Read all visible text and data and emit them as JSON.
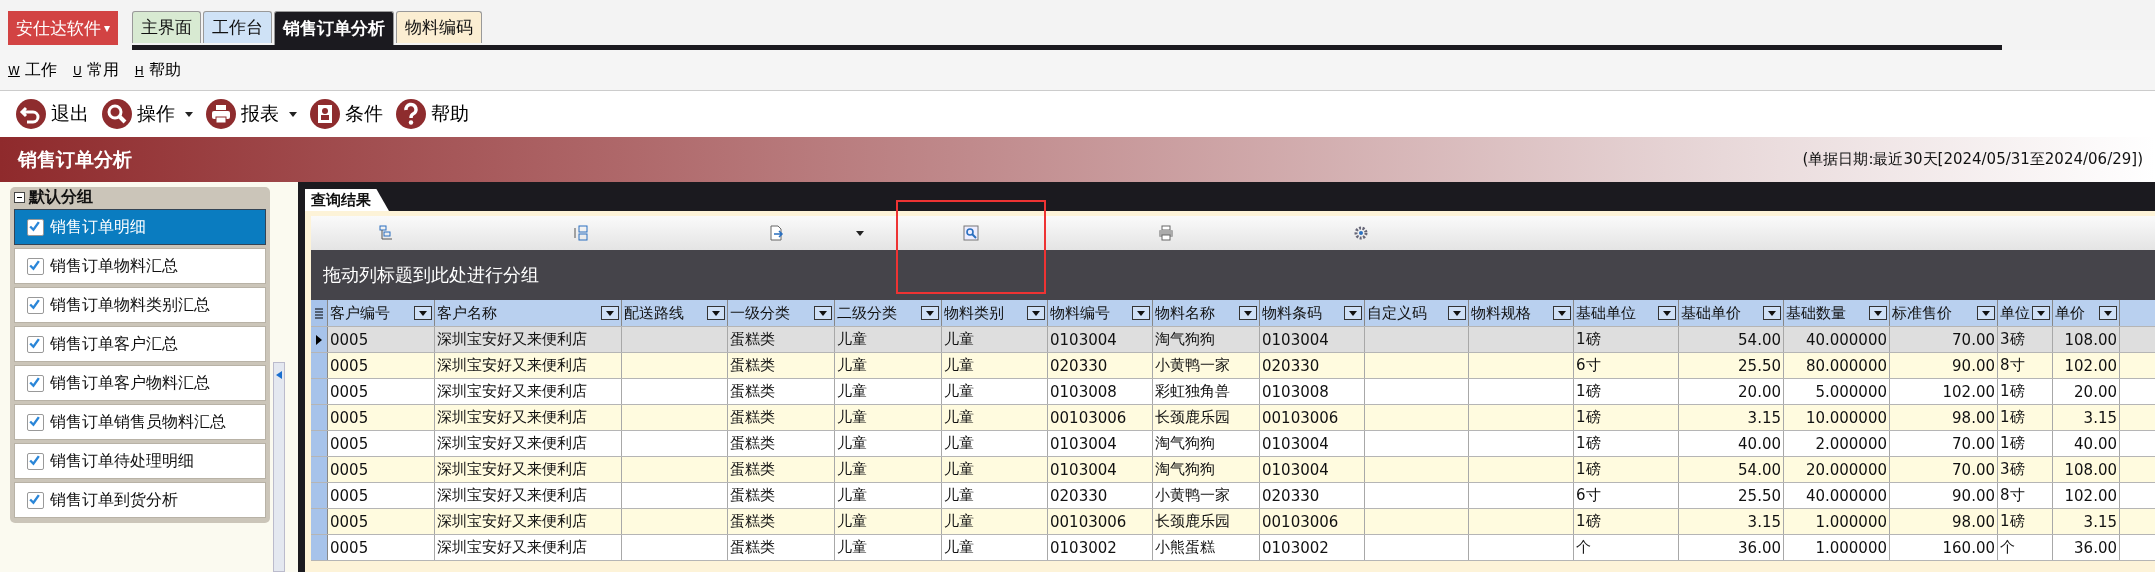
{
  "app_menu": {
    "label": "安仕达软件",
    "caret": "▾"
  },
  "tabs": [
    {
      "label": "主界面",
      "selected": false,
      "color": "#d8ead2"
    },
    {
      "label": "工作台",
      "selected": false,
      "color": "#cfe2f6"
    },
    {
      "label": "销售订单分析",
      "selected": true,
      "color": "#1b1a1f"
    },
    {
      "label": "物料编码",
      "selected": false,
      "color": "#fbeed2"
    }
  ],
  "menu": [
    {
      "key": "W",
      "label": "工作"
    },
    {
      "key": "U",
      "label": "常用"
    },
    {
      "key": "H",
      "label": "帮助"
    }
  ],
  "toolbar": [
    {
      "kind": "exit",
      "label": "退出",
      "dropdown": false
    },
    {
      "kind": "search",
      "label": "操作",
      "dropdown": true
    },
    {
      "kind": "print",
      "label": "报表",
      "dropdown": true
    },
    {
      "kind": "card",
      "label": "条件",
      "dropdown": false
    },
    {
      "kind": "help",
      "label": "帮助",
      "dropdown": false
    }
  ],
  "title_bar": {
    "title": "销售订单分析",
    "date_range": "(单据日期:最近30天[2024/05/31至2024/06/29])"
  },
  "sidebar": {
    "group": {
      "label": "默认分组",
      "expanded": true
    },
    "items": [
      {
        "label": "销售订单明细",
        "checked": true,
        "selected": true
      },
      {
        "label": "销售订单物料汇总",
        "checked": true,
        "selected": false
      },
      {
        "label": "销售订单物料类别汇总",
        "checked": true,
        "selected": false
      },
      {
        "label": "销售订单客户汇总",
        "checked": true,
        "selected": false
      },
      {
        "label": "销售订单客户物料汇总",
        "checked": true,
        "selected": false
      },
      {
        "label": "销售订单销售员物料汇总",
        "checked": true,
        "selected": false
      },
      {
        "label": "销售订单待处理明细",
        "checked": true,
        "selected": false
      },
      {
        "label": "销售订单到货分析",
        "checked": true,
        "selected": false
      }
    ]
  },
  "result_tab": {
    "label": "查询结果"
  },
  "grid_toolbar": [
    {
      "kind": "expand"
    },
    {
      "kind": "collapse"
    },
    {
      "kind": "export",
      "dropdown": true
    },
    {
      "kind": "find",
      "highlighted": true
    },
    {
      "kind": "print"
    },
    {
      "kind": "settings"
    }
  ],
  "group_panel": {
    "hint": "拖动列标题到此处进行分组"
  },
  "table": {
    "columns": [
      {
        "label": "客户编号",
        "kind": "text"
      },
      {
        "label": "客户名称",
        "kind": "text"
      },
      {
        "label": "配送路线",
        "kind": "text"
      },
      {
        "label": "一级分类",
        "kind": "text"
      },
      {
        "label": "二级分类",
        "kind": "text"
      },
      {
        "label": "物料类别",
        "kind": "text"
      },
      {
        "label": "物料编号",
        "kind": "text"
      },
      {
        "label": "物料名称",
        "kind": "text"
      },
      {
        "label": "物料条码",
        "kind": "text"
      },
      {
        "label": "自定义码",
        "kind": "text"
      },
      {
        "label": "物料规格",
        "kind": "text"
      },
      {
        "label": "基础单位",
        "kind": "text"
      },
      {
        "label": "基础单价",
        "kind": "number"
      },
      {
        "label": "基础数量",
        "kind": "number"
      },
      {
        "label": "标准售价",
        "kind": "number"
      },
      {
        "label": "单位",
        "kind": "text"
      },
      {
        "label": "单价",
        "kind": "number"
      }
    ],
    "rows": [
      {
        "selected": true,
        "cells": [
          "0005",
          "深圳宝安好又来便利店",
          "",
          "蛋糕类",
          "儿童",
          "儿童",
          "0103004",
          "淘气狗狗",
          "0103004",
          "",
          "",
          "1磅",
          "54.00",
          "40.000000",
          "70.00",
          "3磅",
          "108.00"
        ]
      },
      {
        "selected": false,
        "cells": [
          "0005",
          "深圳宝安好又来便利店",
          "",
          "蛋糕类",
          "儿童",
          "儿童",
          "020330",
          "小黄鸭一家",
          "020330",
          "",
          "",
          "6寸",
          "25.50",
          "80.000000",
          "90.00",
          "8寸",
          "102.00"
        ]
      },
      {
        "selected": false,
        "cells": [
          "0005",
          "深圳宝安好又来便利店",
          "",
          "蛋糕类",
          "儿童",
          "儿童",
          "0103008",
          "彩虹独角兽",
          "0103008",
          "",
          "",
          "1磅",
          "20.00",
          "5.000000",
          "102.00",
          "1磅",
          "20.00"
        ]
      },
      {
        "selected": false,
        "cells": [
          "0005",
          "深圳宝安好又来便利店",
          "",
          "蛋糕类",
          "儿童",
          "儿童",
          "00103006",
          "长颈鹿乐园",
          "00103006",
          "",
          "",
          "1磅",
          "3.15",
          "10.000000",
          "98.00",
          "1磅",
          "3.15"
        ]
      },
      {
        "selected": false,
        "cells": [
          "0005",
          "深圳宝安好又来便利店",
          "",
          "蛋糕类",
          "儿童",
          "儿童",
          "0103004",
          "淘气狗狗",
          "0103004",
          "",
          "",
          "1磅",
          "40.00",
          "2.000000",
          "70.00",
          "1磅",
          "40.00"
        ]
      },
      {
        "selected": false,
        "cells": [
          "0005",
          "深圳宝安好又来便利店",
          "",
          "蛋糕类",
          "儿童",
          "儿童",
          "0103004",
          "淘气狗狗",
          "0103004",
          "",
          "",
          "1磅",
          "54.00",
          "20.000000",
          "70.00",
          "3磅",
          "108.00"
        ]
      },
      {
        "selected": false,
        "cells": [
          "0005",
          "深圳宝安好又来便利店",
          "",
          "蛋糕类",
          "儿童",
          "儿童",
          "020330",
          "小黄鸭一家",
          "020330",
          "",
          "",
          "6寸",
          "25.50",
          "40.000000",
          "90.00",
          "8寸",
          "102.00"
        ]
      },
      {
        "selected": false,
        "cells": [
          "0005",
          "深圳宝安好又来便利店",
          "",
          "蛋糕类",
          "儿童",
          "儿童",
          "00103006",
          "长颈鹿乐园",
          "00103006",
          "",
          "",
          "1磅",
          "3.15",
          "1.000000",
          "98.00",
          "1磅",
          "3.15"
        ]
      },
      {
        "selected": false,
        "cells": [
          "0005",
          "深圳宝安好又来便利店",
          "",
          "蛋糕类",
          "儿童",
          "儿童",
          "0103002",
          "小熊蛋糕",
          "0103002",
          "",
          "",
          "个",
          "36.00",
          "1.000000",
          "160.00",
          "个",
          "36.00"
        ]
      }
    ]
  }
}
